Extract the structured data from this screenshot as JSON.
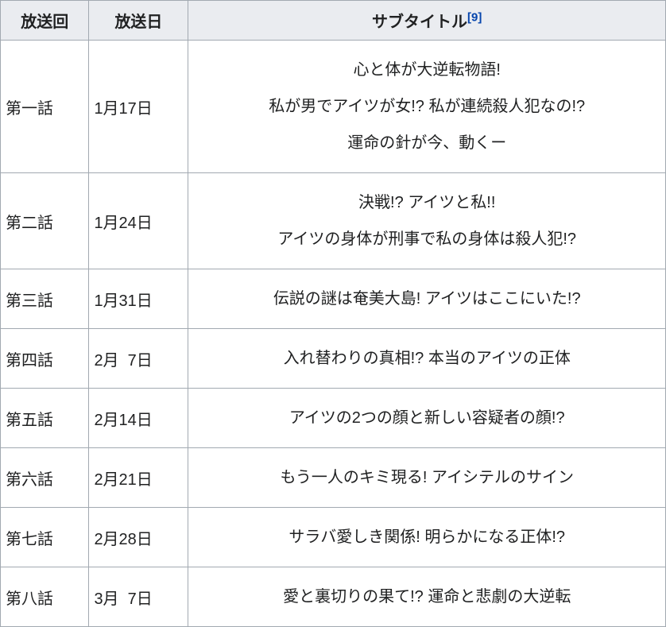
{
  "headers": {
    "ep": "放送回",
    "date": "放送日",
    "subtitle": "サブタイトル",
    "ref": "[9]"
  },
  "rows": [
    {
      "ep": "第一話",
      "date": "1月17日",
      "subtitle": "心と体が大逆転物語!<br>私が男でアイツが女!? 私が連続殺人犯なの!?<br>運命の針が今、動くー"
    },
    {
      "ep": "第二話",
      "date": "1月24日",
      "subtitle": "決戦!? アイツと私!!<br>アイツの身体が刑事で私の身体は殺人犯!?"
    },
    {
      "ep": "第三話",
      "date": "1月31日",
      "subtitle": "伝説の謎は奄美大島! アイツはここにいた!?"
    },
    {
      "ep": "第四話",
      "date": "2月 7日",
      "subtitle": "入れ替わりの真相!? 本当のアイツの正体"
    },
    {
      "ep": "第五話",
      "date": "2月14日",
      "subtitle": "アイツの2つの顔と新しい容疑者の顔!?"
    },
    {
      "ep": "第六話",
      "date": "2月21日",
      "subtitle": "もう一人のキミ現る! アイシテルのサイン"
    },
    {
      "ep": "第七話",
      "date": "2月28日",
      "subtitle": "サラバ愛しき関係! 明らかになる正体!?"
    },
    {
      "ep": "第八話",
      "date": "3月 7日",
      "subtitle": "愛と裏切りの果て!? 運命と悲劇の大逆転"
    }
  ]
}
